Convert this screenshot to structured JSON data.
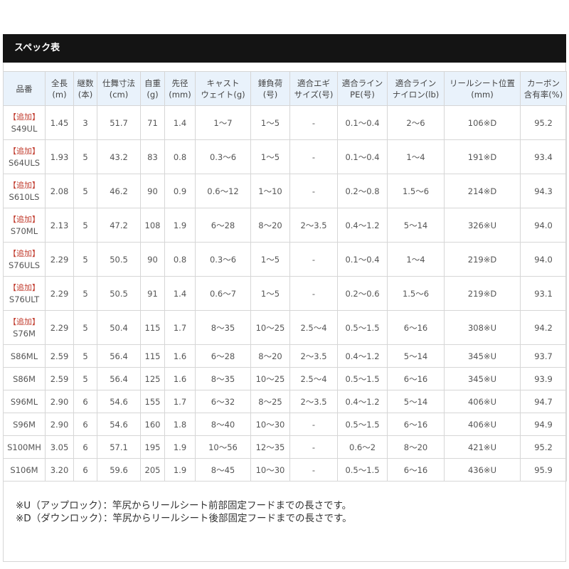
{
  "title": "スペック表",
  "headers": [
    [
      "品番"
    ],
    [
      "全長",
      "(m)"
    ],
    [
      "継数",
      "(本)"
    ],
    [
      "仕舞寸法",
      "(cm)"
    ],
    [
      "自重",
      "(g)"
    ],
    [
      "先径",
      "(mm)"
    ],
    [
      "キャスト",
      "ウェイト(g)"
    ],
    [
      "錘負荷",
      "(号)"
    ],
    [
      "適合エギ",
      "サイズ(号)"
    ],
    [
      "適合ライン",
      "PE(号)"
    ],
    [
      "適合ライン",
      "ナイロン(lb)"
    ],
    [
      "リールシート位置",
      "(mm)"
    ],
    [
      "カーボン",
      "含有率(%)"
    ]
  ],
  "rows": [
    {
      "tag": "【追加】",
      "model": "S49UL",
      "cells": [
        "1.45",
        "3",
        "51.7",
        "71",
        "1.4",
        "1〜7",
        "1〜5",
        "-",
        "0.1〜0.4",
        "2〜6",
        "106※D",
        "95.2"
      ]
    },
    {
      "tag": "【追加】",
      "model": "S64ULS",
      "cells": [
        "1.93",
        "5",
        "43.2",
        "83",
        "0.8",
        "0.3〜6",
        "1〜5",
        "-",
        "0.1〜0.4",
        "1〜4",
        "191※D",
        "93.4"
      ]
    },
    {
      "tag": "【追加】",
      "model": "S610LS",
      "cells": [
        "2.08",
        "5",
        "46.2",
        "90",
        "0.9",
        "0.6〜12",
        "1〜10",
        "-",
        "0.2〜0.8",
        "1.5〜6",
        "214※D",
        "94.3"
      ]
    },
    {
      "tag": "【追加】",
      "model": "S70ML",
      "cells": [
        "2.13",
        "5",
        "47.2",
        "108",
        "1.9",
        "6〜28",
        "8〜20",
        "2〜3.5",
        "0.4〜1.2",
        "5〜14",
        "326※U",
        "94.0"
      ]
    },
    {
      "tag": "【追加】",
      "model": "S76ULS",
      "cells": [
        "2.29",
        "5",
        "50.5",
        "90",
        "0.8",
        "0.3〜6",
        "1〜5",
        "-",
        "0.1〜0.4",
        "1〜4",
        "219※D",
        "94.0"
      ]
    },
    {
      "tag": "【追加】",
      "model": "S76ULT",
      "cells": [
        "2.29",
        "5",
        "50.5",
        "91",
        "1.4",
        "0.6〜7",
        "1〜5",
        "-",
        "0.2〜0.6",
        "1.5〜6",
        "219※D",
        "93.1"
      ]
    },
    {
      "tag": "【追加】",
      "model": "S76M",
      "cells": [
        "2.29",
        "5",
        "50.4",
        "115",
        "1.7",
        "8〜35",
        "10〜25",
        "2.5〜4",
        "0.5〜1.5",
        "6〜16",
        "308※U",
        "94.2"
      ]
    },
    {
      "tag": "",
      "model": "S86ML",
      "cells": [
        "2.59",
        "5",
        "56.4",
        "115",
        "1.6",
        "6〜28",
        "8〜20",
        "2〜3.5",
        "0.4〜1.2",
        "5〜14",
        "345※U",
        "93.7"
      ]
    },
    {
      "tag": "",
      "model": "S86M",
      "cells": [
        "2.59",
        "5",
        "56.4",
        "125",
        "1.6",
        "8〜35",
        "10〜25",
        "2.5〜4",
        "0.5〜1.5",
        "6〜16",
        "345※U",
        "93.9"
      ]
    },
    {
      "tag": "",
      "model": "S96ML",
      "cells": [
        "2.90",
        "6",
        "54.6",
        "155",
        "1.7",
        "6〜32",
        "8〜25",
        "2〜3.5",
        "0.4〜1.2",
        "5〜14",
        "406※U",
        "94.7"
      ]
    },
    {
      "tag": "",
      "model": "S96M",
      "cells": [
        "2.90",
        "6",
        "54.6",
        "160",
        "1.8",
        "8〜40",
        "10〜30",
        "-",
        "0.5〜1.5",
        "6〜16",
        "406※U",
        "94.9"
      ]
    },
    {
      "tag": "",
      "model": "S100MH",
      "cells": [
        "3.05",
        "6",
        "57.1",
        "195",
        "1.9",
        "10〜56",
        "12〜35",
        "-",
        "0.6〜2",
        "8〜20",
        "421※U",
        "95.2"
      ]
    },
    {
      "tag": "",
      "model": "S106M",
      "cells": [
        "3.20",
        "6",
        "59.6",
        "205",
        "1.9",
        "8〜45",
        "10〜30",
        "-",
        "0.5〜1.5",
        "6〜16",
        "436※U",
        "95.9"
      ]
    }
  ],
  "notes": [
    "※U（アップロック）：竿尻からリールシート前部固定フードまでの長さです。",
    "※D（ダウンロック）：竿尻からリールシート後部固定フードまでの長さです。"
  ],
  "colors": {
    "title_bar": "#141414",
    "header_bg": "#e9f2fb",
    "tag_red": "#c0392b",
    "border": "#d6d6d6"
  }
}
